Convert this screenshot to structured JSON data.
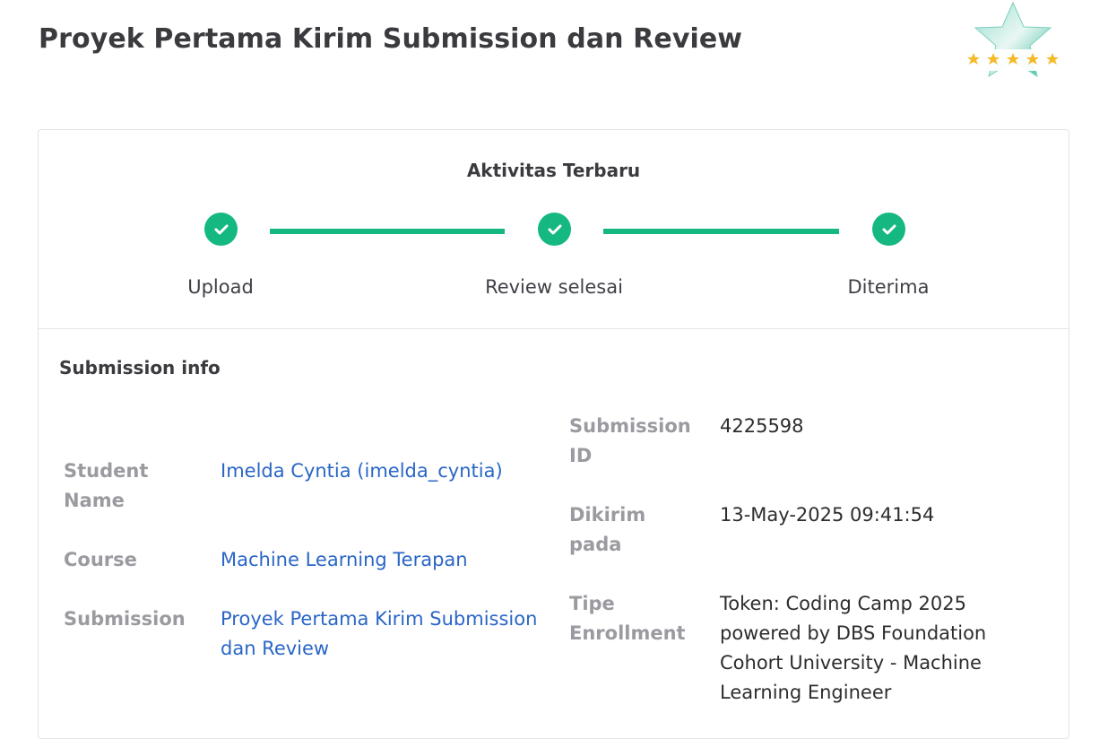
{
  "page": {
    "title": "Proyek Pertama Kirim Submission dan Review"
  },
  "badge": {
    "icon": "star-rating-badge-icon",
    "stars": 5,
    "colors": {
      "star": "#f6b928",
      "badge": "#5fc9b6"
    }
  },
  "activity": {
    "title": "Aktivitas Terbaru",
    "accent_color": "#15b881",
    "steps": [
      {
        "label": "Upload",
        "icon": "check-icon",
        "done": true
      },
      {
        "label": "Review selesai",
        "icon": "check-icon",
        "done": true
      },
      {
        "label": "Diterima",
        "icon": "check-icon",
        "done": true
      }
    ]
  },
  "submission_info": {
    "title": "Submission info",
    "left": [
      {
        "label": "Student Name",
        "value": "Imelda Cyntia (imelda_cyntia)"
      },
      {
        "label": "Course",
        "value": "Machine Learning Terapan"
      },
      {
        "label": "Submission",
        "value": "Proyek Pertama Kirim Submission dan Review"
      }
    ],
    "right": [
      {
        "label": "Submission ID",
        "value": "4225598"
      },
      {
        "label": "Dikirim pada",
        "value": "13-May-2025 09:41:54"
      },
      {
        "label": "Tipe Enrollment",
        "value": "Token: Coding Camp 2025 powered by DBS Foundation Cohort University - Machine Learning Engineer"
      }
    ],
    "colors": {
      "label": "#9a9aa0",
      "link": "#2a66c6"
    }
  }
}
